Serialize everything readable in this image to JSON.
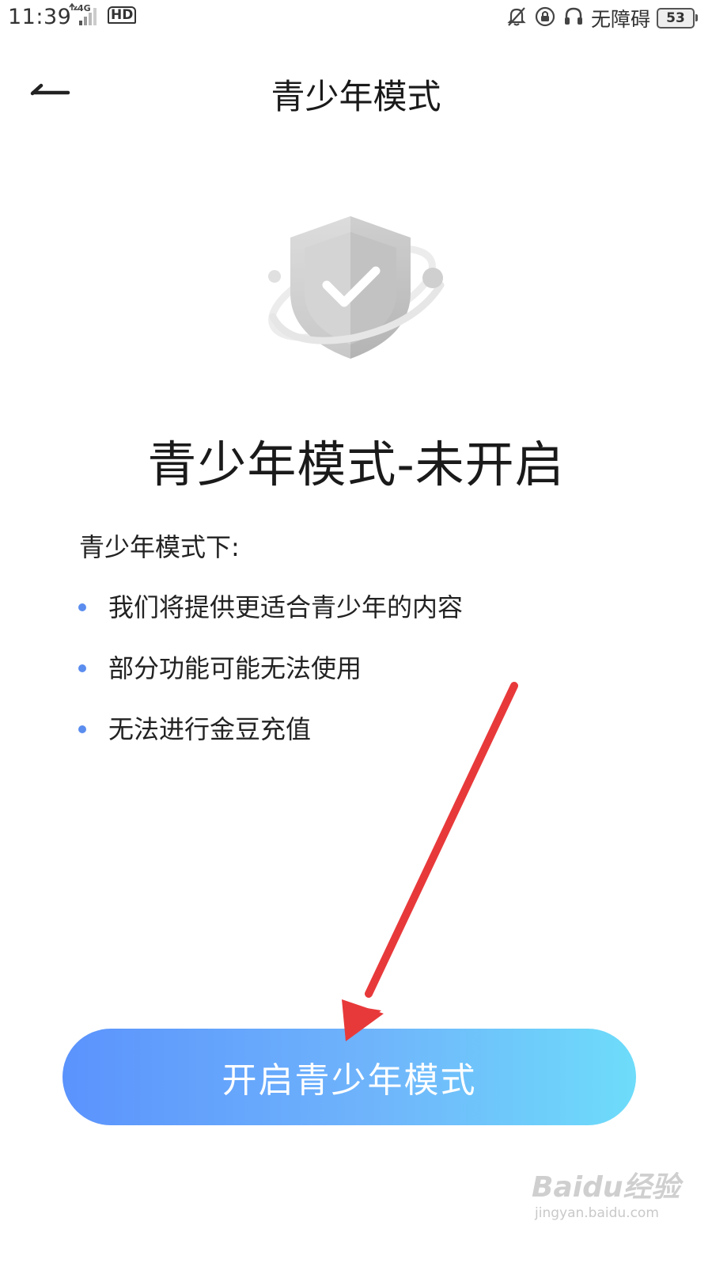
{
  "status_bar": {
    "time": "11:39",
    "network": "4G",
    "hd_label": "HD",
    "accessibility": "无障碍",
    "battery": "53"
  },
  "nav": {
    "title": "青少年模式"
  },
  "status": {
    "title": "青少年模式-未开启"
  },
  "intro": "青少年模式下:",
  "features": [
    "我们将提供更适合青少年的内容",
    "部分功能可能无法使用",
    "无法进行金豆充值"
  ],
  "primary_button": "开启青少年模式",
  "watermark": {
    "logo": "Baidu经验",
    "url": "jingyan.baidu.com"
  },
  "colors": {
    "bullet": "#5b8def",
    "button_gradient": [
      "#5b93fd",
      "#6edcfa"
    ],
    "annotation_arrow": "#e8393a"
  }
}
